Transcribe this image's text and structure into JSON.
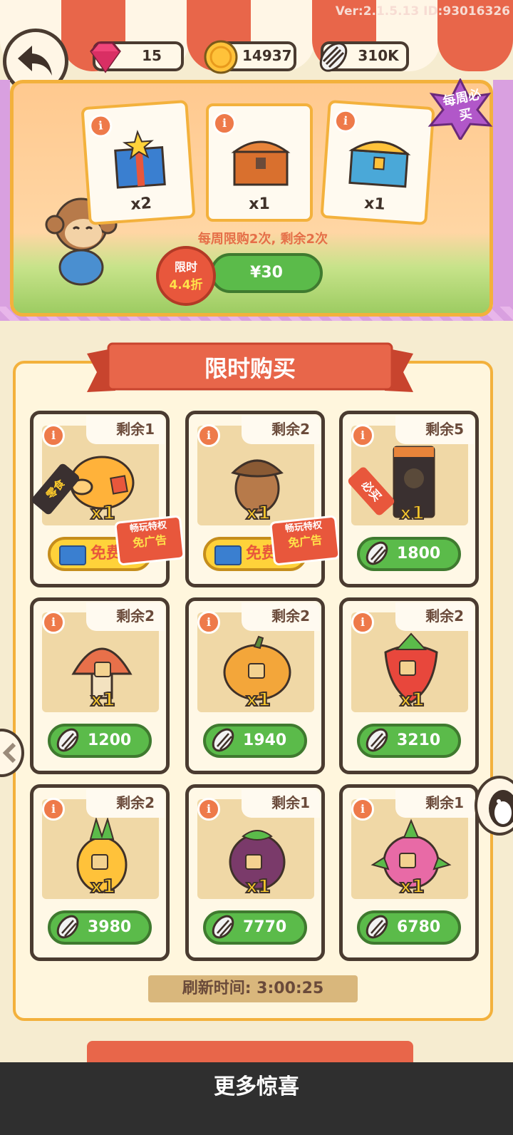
{
  "top": {
    "version": "Ver:2.1.5.13 ID:93016326",
    "gems": "15",
    "coins": "14937",
    "seeds": "310K"
  },
  "weekly": {
    "badge": "每周必买",
    "items": [
      {
        "qty": "x2",
        "icon": "gift-box-icon"
      },
      {
        "qty": "x1",
        "icon": "wooden-chest-icon"
      },
      {
        "qty": "x1",
        "icon": "blue-chest-icon"
      }
    ],
    "limit_text": "每周限购2次, 剩余2次",
    "discount_line1": "限时",
    "discount_line2": "4.4折",
    "price": "¥30"
  },
  "shop": {
    "title": "限时购买",
    "info_label": "i",
    "free_label": "免费",
    "adfree_line1": "畅玩特权",
    "adfree_line2": "免广告",
    "items": [
      {
        "remain": "剩余1",
        "qty": "x1",
        "icon": "piggy-bank-icon",
        "price": "",
        "free": true,
        "tag": "零食"
      },
      {
        "remain": "剩余2",
        "qty": "x1",
        "icon": "acorn-icon",
        "price": "",
        "free": true,
        "tag": ""
      },
      {
        "remain": "剩余5",
        "qty": "x1",
        "icon": "cat-food-bag-icon",
        "price": "1800",
        "free": false,
        "tag": "必买"
      },
      {
        "remain": "剩余2",
        "qty": "x1",
        "icon": "mushroom-icon",
        "price": "1200",
        "free": false,
        "tag": ""
      },
      {
        "remain": "剩余2",
        "qty": "x1",
        "icon": "pumpkin-icon",
        "price": "1940",
        "free": false,
        "tag": ""
      },
      {
        "remain": "剩余2",
        "qty": "x1",
        "icon": "strawberry-icon",
        "price": "3210",
        "free": false,
        "tag": ""
      },
      {
        "remain": "剩余2",
        "qty": "x1",
        "icon": "pineapple-icon",
        "price": "3980",
        "free": false,
        "tag": ""
      },
      {
        "remain": "剩余1",
        "qty": "x1",
        "icon": "mangosteen-icon",
        "price": "7770",
        "free": false,
        "tag": ""
      },
      {
        "remain": "剩余1",
        "qty": "x1",
        "icon": "dragon-fruit-icon",
        "price": "6780",
        "free": false,
        "tag": ""
      }
    ],
    "refresh": "刷新时间: 3:00:25"
  },
  "bottom": {
    "label": "更多惊喜"
  },
  "colors": {
    "accent_green": "#5bbb4a",
    "accent_red": "#e8573c",
    "frame_gold": "#f3b13c",
    "outline": "#4a3b30"
  }
}
